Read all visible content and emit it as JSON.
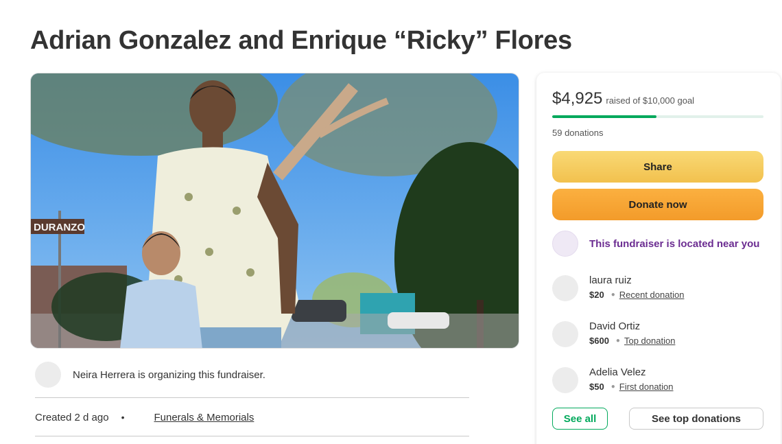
{
  "page": {
    "title": "Adrian Gonzalez and Enrique “Ricky” Flores"
  },
  "hero": {
    "street_sign": "DURANZO"
  },
  "organizer": {
    "text": "Neira Herrera is organizing this fundraiser."
  },
  "meta": {
    "created": "Created 2 d ago",
    "separator": "•",
    "category": "Funerals & Memorials"
  },
  "donation_panel": {
    "raised_amount": "$4,925",
    "raised_goal_text": "raised of $10,000 goal",
    "progress_fraction": 0.4925,
    "donation_count": "59 donations",
    "share_label": "Share",
    "donate_label": "Donate now",
    "nearby_text": "This fundraiser is located near you",
    "donors": [
      {
        "name": "laura ruiz",
        "amount": "$20",
        "tag": "Recent donation"
      },
      {
        "name": "David Ortiz",
        "amount": "$600",
        "tag": "Top donation"
      },
      {
        "name": "Adelia Velez",
        "amount": "$50",
        "tag": "First donation"
      }
    ],
    "see_all_label": "See all",
    "see_top_label": "See top donations"
  },
  "colors": {
    "accent_green": "#02a95c",
    "nearby_purple": "#6b2c91",
    "share_yellow": "#f2c14e",
    "donate_orange": "#f39b2a"
  },
  "icons": {
    "avatar": "person-avatar-placeholder"
  }
}
